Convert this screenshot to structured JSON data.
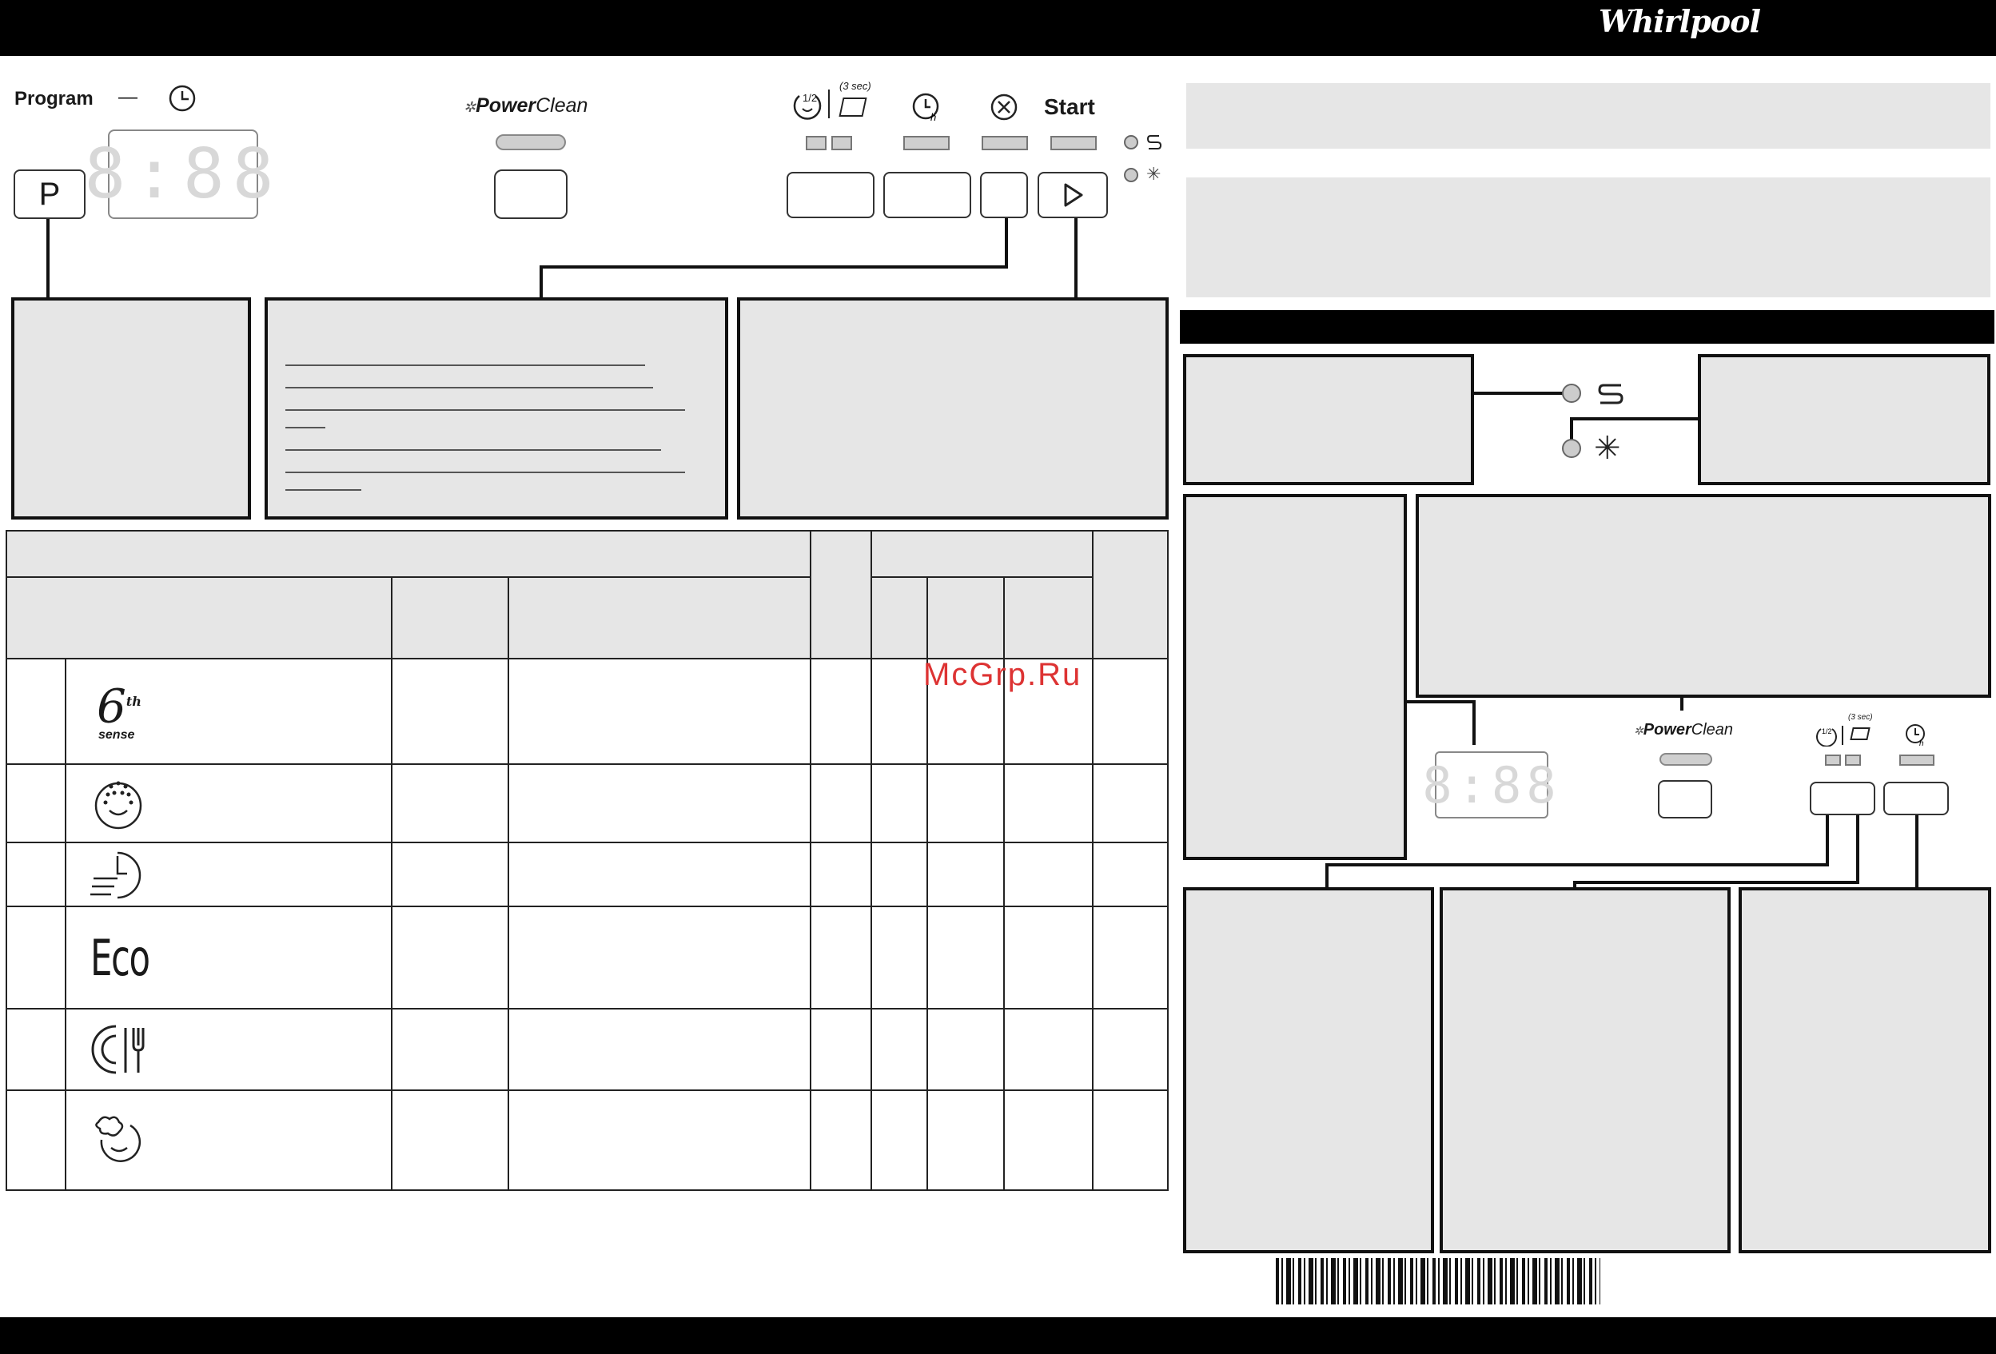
{
  "header": {
    "brand": "Whirlpool"
  },
  "panel": {
    "program_label": "Program",
    "program_dash": "—",
    "program_button": "P",
    "display_digits": "8:88",
    "powerclean_prefix": "Power",
    "powerclean_suffix": "Clean",
    "half_load_label": "1/2",
    "three_sec_label": "(3 sec)",
    "start_label": "Start"
  },
  "mini_panel": {
    "display_digits": "8:88",
    "powerclean_prefix": "Power",
    "powerclean_suffix": "Clean",
    "half_load_label": "1/2",
    "three_sec_label": "(3 sec)"
  },
  "programs": [
    {
      "icon": "sixth-sense-icon",
      "sup": "th",
      "sub": "sense",
      "num": "6"
    },
    {
      "icon": "intensive-icon"
    },
    {
      "icon": "quick-wash-icon"
    },
    {
      "icon": "eco-icon",
      "text": "Eco"
    },
    {
      "icon": "dishes-cutlery-icon"
    },
    {
      "icon": "pre-wash-icon"
    }
  ],
  "watermark": "McGrp.Ru"
}
